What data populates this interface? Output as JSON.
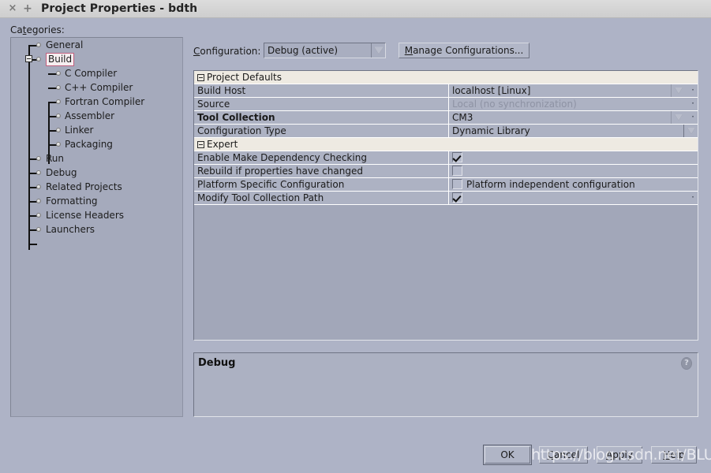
{
  "window": {
    "title": "Project Properties - bdth",
    "close_icon": "close-icon",
    "new_icon": "plus-icon"
  },
  "categories": {
    "label": "Categories:",
    "label_mnemonic": "t",
    "selected": "Build",
    "items": [
      {
        "label": "General",
        "level": 1,
        "selected": false,
        "expandable": false
      },
      {
        "label": "Build",
        "level": 1,
        "selected": true,
        "expandable": true
      },
      {
        "label": "C Compiler",
        "level": 2,
        "selected": false,
        "expandable": false
      },
      {
        "label": "C++ Compiler",
        "level": 2,
        "selected": false,
        "expandable": false
      },
      {
        "label": "Fortran Compiler",
        "level": 2,
        "selected": false,
        "expandable": false
      },
      {
        "label": "Assembler",
        "level": 2,
        "selected": false,
        "expandable": false
      },
      {
        "label": "Linker",
        "level": 2,
        "selected": false,
        "expandable": false
      },
      {
        "label": "Packaging",
        "level": 2,
        "selected": false,
        "expandable": false
      },
      {
        "label": "Run",
        "level": 1,
        "selected": false,
        "expandable": false
      },
      {
        "label": "Debug",
        "level": 1,
        "selected": false,
        "expandable": false
      },
      {
        "label": "Related Projects",
        "level": 1,
        "selected": false,
        "expandable": false
      },
      {
        "label": "Formatting",
        "level": 1,
        "selected": false,
        "expandable": false
      },
      {
        "label": "License Headers",
        "level": 1,
        "selected": false,
        "expandable": false
      },
      {
        "label": "Launchers",
        "level": 1,
        "selected": false,
        "expandable": false
      }
    ]
  },
  "configuration": {
    "label": "Configuration:",
    "label_mnemonic": "C",
    "value": "Debug (active)",
    "dropdown_icon": "chevron-down-icon",
    "manage_button": "Manage Configurations...",
    "manage_button_mnemonic": "M"
  },
  "properties": {
    "sections": [
      {
        "title": "Project Defaults",
        "expander_icon": "collapse-minus-icon",
        "rows": [
          {
            "name": "Build Host",
            "bold": false,
            "type": "text",
            "value": "localhost [Linux]",
            "dim": false,
            "dropdown": true,
            "dropdown_state": "normal",
            "ellipsis": true
          },
          {
            "name": "Source",
            "bold": false,
            "type": "text",
            "value": "Local (no synchronization)",
            "dim": true,
            "dropdown": false,
            "dropdown_state": "none",
            "ellipsis": true
          },
          {
            "name": "Tool Collection",
            "bold": true,
            "type": "text",
            "value": "CM3",
            "dim": false,
            "dropdown": true,
            "dropdown_state": "normal",
            "ellipsis": true
          },
          {
            "name": "Configuration Type",
            "bold": false,
            "type": "text",
            "value": "Dynamic Library",
            "dim": false,
            "dropdown": true,
            "dropdown_state": "active",
            "ellipsis": false
          }
        ]
      },
      {
        "title": "Expert",
        "expander_icon": "collapse-minus-icon",
        "rows": [
          {
            "name": "Enable Make Dependency Checking",
            "bold": false,
            "type": "checkbox",
            "checked": true,
            "checkbox_label": "",
            "ellipsis": false
          },
          {
            "name": "Rebuild if properties have changed",
            "bold": false,
            "type": "checkbox",
            "checked": false,
            "checkbox_label": "",
            "ellipsis": false
          },
          {
            "name": "Platform Specific Configuration",
            "bold": false,
            "type": "checkbox",
            "checked": false,
            "checkbox_label": "Platform independent configuration",
            "ellipsis": false
          },
          {
            "name": "Modify Tool Collection Path",
            "bold": false,
            "type": "checkbox",
            "checked": true,
            "checkbox_label": "",
            "ellipsis": true
          }
        ]
      }
    ]
  },
  "description": {
    "title": "Debug",
    "help_icon": "help-question-icon",
    "help_glyph": "?"
  },
  "buttons": {
    "ok": "OK",
    "cancel": "Cancel",
    "cancel_mnemonic": "C",
    "apply": "Apply",
    "apply_mnemonic": "A",
    "help": "Help",
    "help_mnemonic": "H"
  },
  "watermark": {
    "text": "https://blog.csdn.net/BLUE_JIE"
  },
  "colors": {
    "titlebar": "#d4d4d4",
    "body": "#aeb3c6",
    "tree_panel": "#a5aabc",
    "row": "#adb2c3",
    "section_header": "#eeeae2",
    "selection_border": "#c0607e"
  }
}
